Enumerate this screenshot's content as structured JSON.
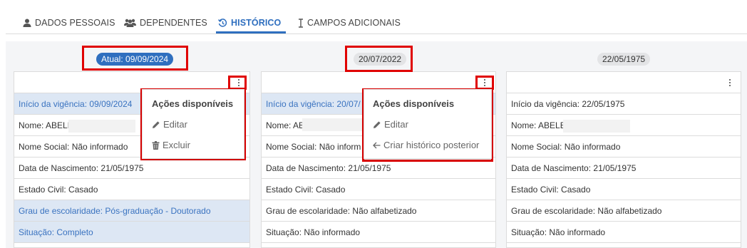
{
  "tabs": [
    {
      "label": "DADOS PESSOAIS",
      "icon": "user-icon"
    },
    {
      "label": "DEPENDENTES",
      "icon": "users-icon"
    },
    {
      "label": "HISTÓRICO",
      "icon": "history-icon",
      "active": true
    },
    {
      "label": "CAMPOS ADICIONAIS",
      "icon": "text-cursor-icon"
    }
  ],
  "colors": {
    "accent": "#2f6fbf",
    "highlight_bg": "#dde7f4",
    "annotation": "#e00000"
  },
  "columns": [
    {
      "date": "Atual: 09/09/2024",
      "rows": [
        "Início da vigência: 09/09/2024",
        "Nome: ABELE",
        "Nome Social: Não informado",
        "Data de Nascimento: 21/05/1975",
        "Estado Civil: Casado",
        "Grau de escolaridade: Pós-graduação - Doutorado",
        "Situação: Completo"
      ]
    },
    {
      "date": "20/07/2022",
      "rows": [
        "Início da vigência: 20/07/",
        "Nome: ABELE",
        "Nome Social: Não inform",
        "Data de Nascimento: 21/05/1975",
        "Estado Civil: Casado",
        "Grau de escolaridade: Não alfabetizado",
        "Situação: Não informado"
      ]
    },
    {
      "date": "22/05/1975",
      "rows": [
        "Início da vigência: 22/05/1975",
        "Nome: ABELE",
        "Nome Social: Não informado",
        "Data de Nascimento: 21/05/1975",
        "Estado Civil: Casado",
        "Grau de escolaridade: Não alfabetizado",
        "Situação: Não informado"
      ]
    }
  ],
  "menu1": {
    "title": "Ações disponíveis",
    "items": [
      "Editar",
      "Excluir"
    ]
  },
  "menu2": {
    "title": "Ações disponíveis",
    "items": [
      "Editar",
      "Criar histórico posterior"
    ]
  }
}
